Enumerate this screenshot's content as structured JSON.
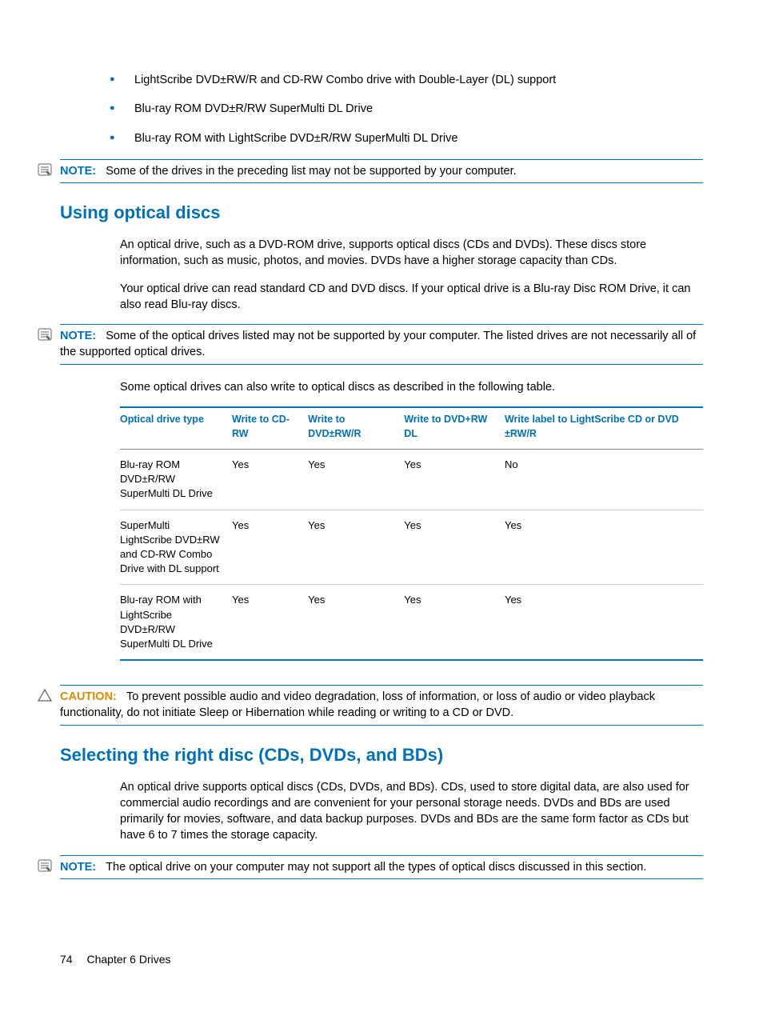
{
  "bullets": [
    "LightScribe DVD±RW/R and CD-RW Combo drive with Double-Layer (DL) support",
    "Blu-ray ROM DVD±R/RW SuperMulti DL Drive",
    "Blu-ray ROM with LightScribe DVD±R/RW SuperMulti DL Drive"
  ],
  "note1": {
    "label": "NOTE:",
    "text": "Some of the drives in the preceding list may not be supported by your computer."
  },
  "section1": {
    "heading": "Using optical discs",
    "para1": "An optical drive, such as a DVD-ROM drive, supports optical discs (CDs and DVDs). These discs store information, such as music, photos, and movies. DVDs have a higher storage capacity than CDs.",
    "para2": "Your optical drive can read standard CD and DVD discs. If your optical drive is a Blu-ray Disc ROM Drive, it can also read Blu-ray discs.",
    "note": {
      "label": "NOTE:",
      "text": "Some of the optical drives listed may not be supported by your computer. The listed drives are not necessarily all of the supported optical drives."
    },
    "para3": "Some optical drives can also write to optical discs as described in the following table."
  },
  "chart_data": {
    "type": "table",
    "headers": [
      "Optical drive type",
      "Write to CD-RW",
      "Write to DVD±RW/R",
      "Write to DVD+RW DL",
      "Write label to LightScribe CD or DVD ±RW/R"
    ],
    "rows": [
      [
        "Blu-ray ROM DVD±R/RW SuperMulti DL Drive",
        "Yes",
        "Yes",
        "Yes",
        "No"
      ],
      [
        "SuperMulti LightScribe DVD±RW and CD-RW Combo Drive with DL support",
        "Yes",
        "Yes",
        "Yes",
        "Yes"
      ],
      [
        "Blu-ray ROM with LightScribe DVD±R/RW SuperMulti DL Drive",
        "Yes",
        "Yes",
        "Yes",
        "Yes"
      ]
    ]
  },
  "caution": {
    "label": "CAUTION:",
    "text": "To prevent possible audio and video degradation, loss of information, or loss of audio or video playback functionality, do not initiate Sleep or Hibernation while reading or writing to a CD or DVD."
  },
  "section2": {
    "heading": "Selecting the right disc (CDs, DVDs, and BDs)",
    "para1": "An optical drive supports optical discs (CDs, DVDs, and BDs). CDs, used to store digital data, are also used for commercial audio recordings and are convenient for your personal storage needs. DVDs and BDs are used primarily for movies, software, and data backup purposes. DVDs and BDs are the same form factor as CDs but have 6 to 7 times the storage capacity.",
    "note": {
      "label": "NOTE:",
      "text": "The optical drive on your computer may not support all the types of optical discs discussed in this section."
    }
  },
  "footer": {
    "page_number": "74",
    "chapter": "Chapter 6   Drives"
  }
}
